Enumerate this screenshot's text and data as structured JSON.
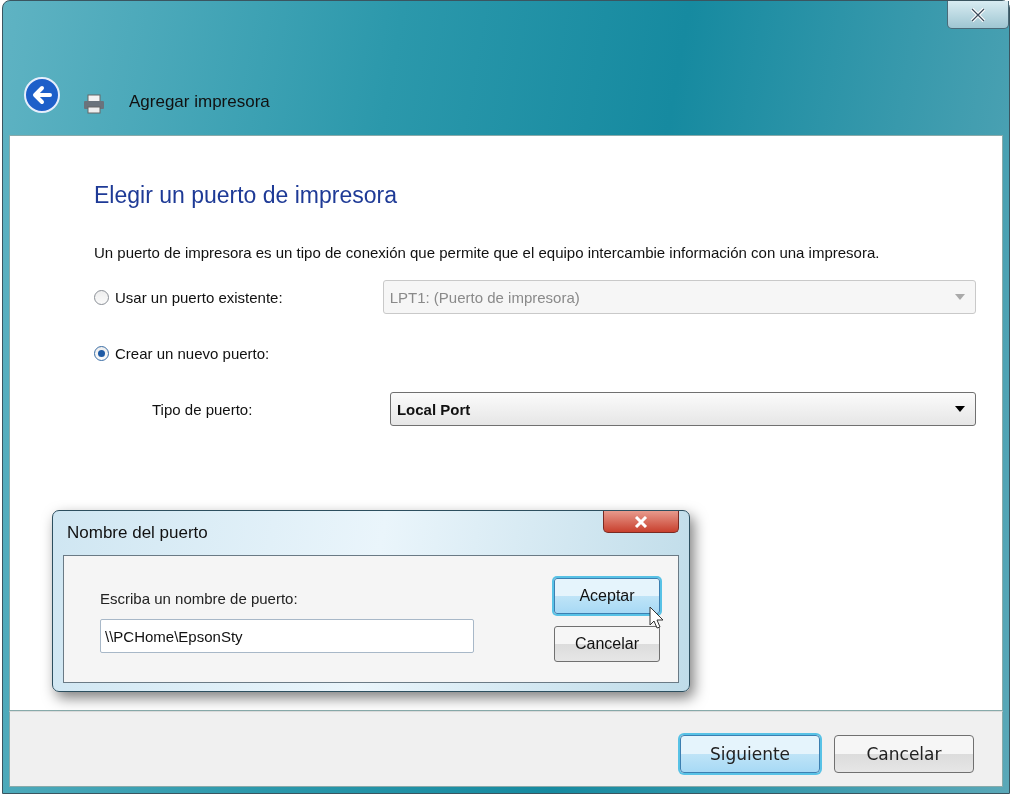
{
  "window": {
    "title": "Agregar impresora"
  },
  "heading": "Elegir un puerto de impresora",
  "description": "Un puerto de impresora es un tipo de conexión que permite que el equipo intercambie información con una impresora.",
  "port_options": [
    {
      "label": "Usar un puerto existente:",
      "selected": false,
      "dropdown": {
        "value": "LPT1: (Puerto de impresora)",
        "disabled": true
      }
    },
    {
      "label": "Crear un nuevo puerto:",
      "selected": true
    }
  ],
  "port_type": {
    "label": "Tipo de puerto:",
    "value": "Local Port",
    "disabled": false
  },
  "buttons": [
    {
      "label": "Siguiente",
      "default": true
    },
    {
      "label": "Cancelar",
      "default": false
    }
  ],
  "dialog": {
    "title": "Nombre del puerto",
    "prompt": "Escriba un nombre de puerto:",
    "value": "\\\\PCHome\\EpsonSty",
    "buttons": [
      {
        "label": "Aceptar",
        "default": true
      },
      {
        "label": "Cancelar",
        "default": false
      }
    ]
  }
}
